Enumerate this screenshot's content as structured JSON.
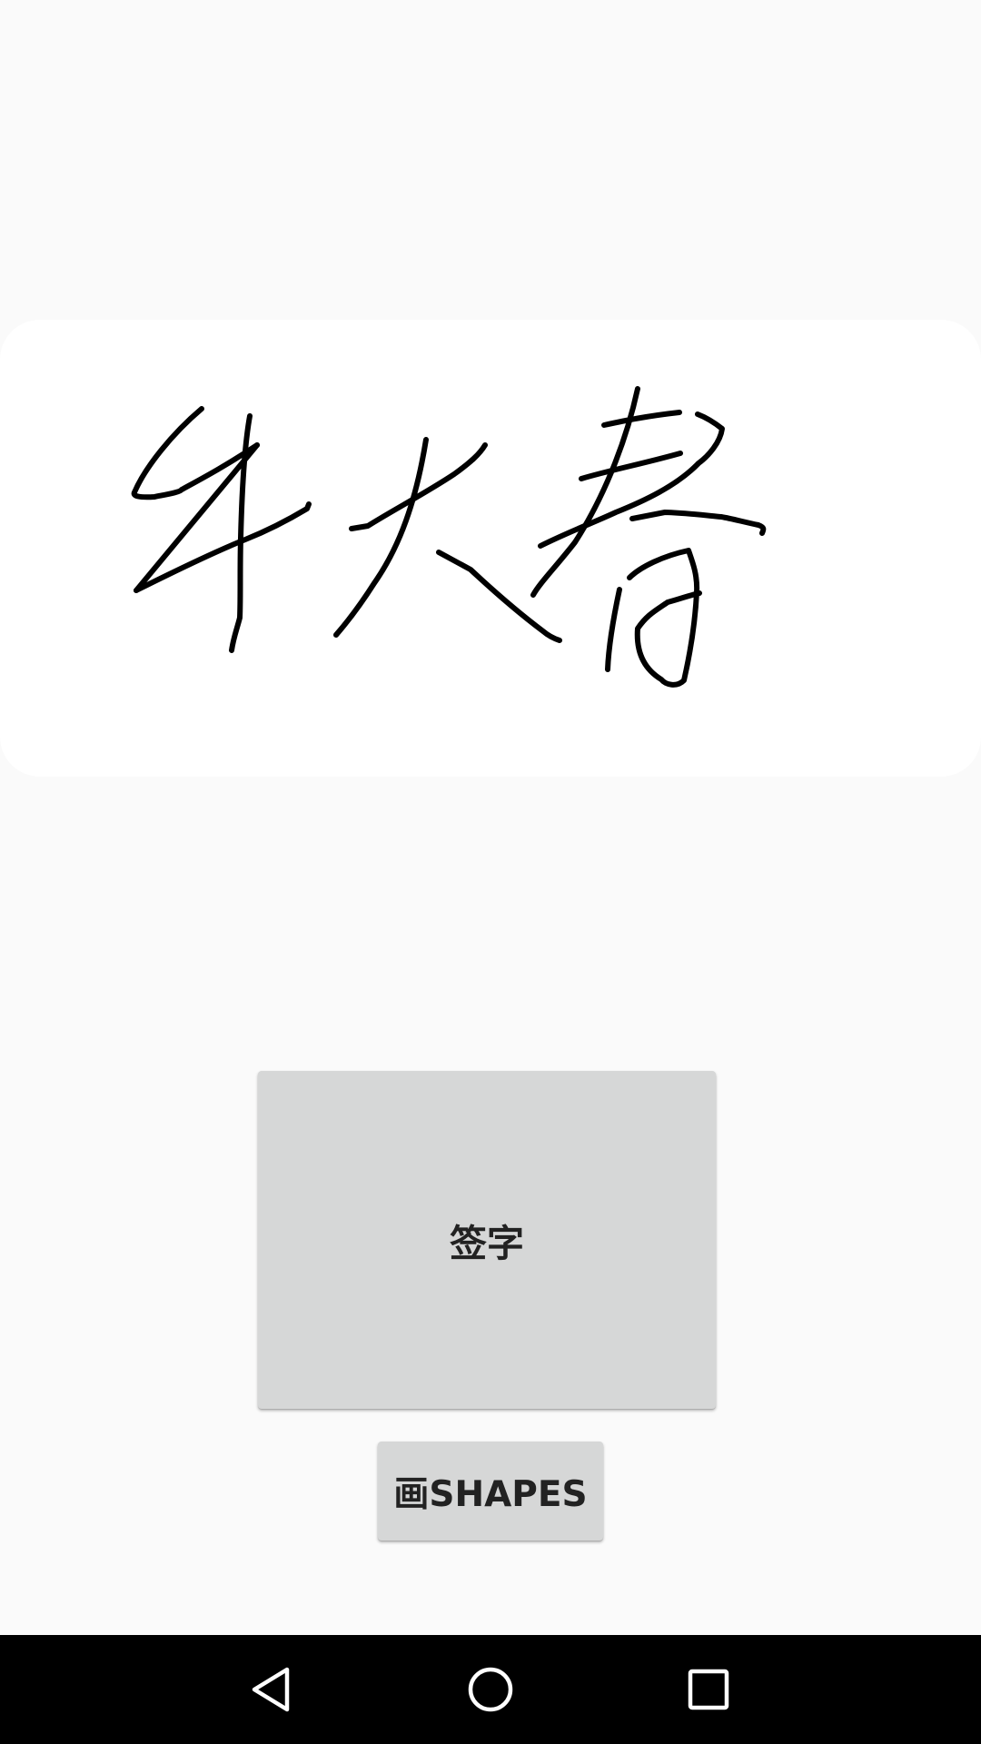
{
  "signature_pad": {
    "ink_color": "#000000",
    "background_color": "#ffffff"
  },
  "buttons": {
    "sign_label": "签字",
    "shapes_label": "画shapes"
  },
  "navigation": {
    "back_icon": "triangle-back-icon",
    "home_icon": "circle-home-icon",
    "recents_icon": "square-recents-icon"
  }
}
